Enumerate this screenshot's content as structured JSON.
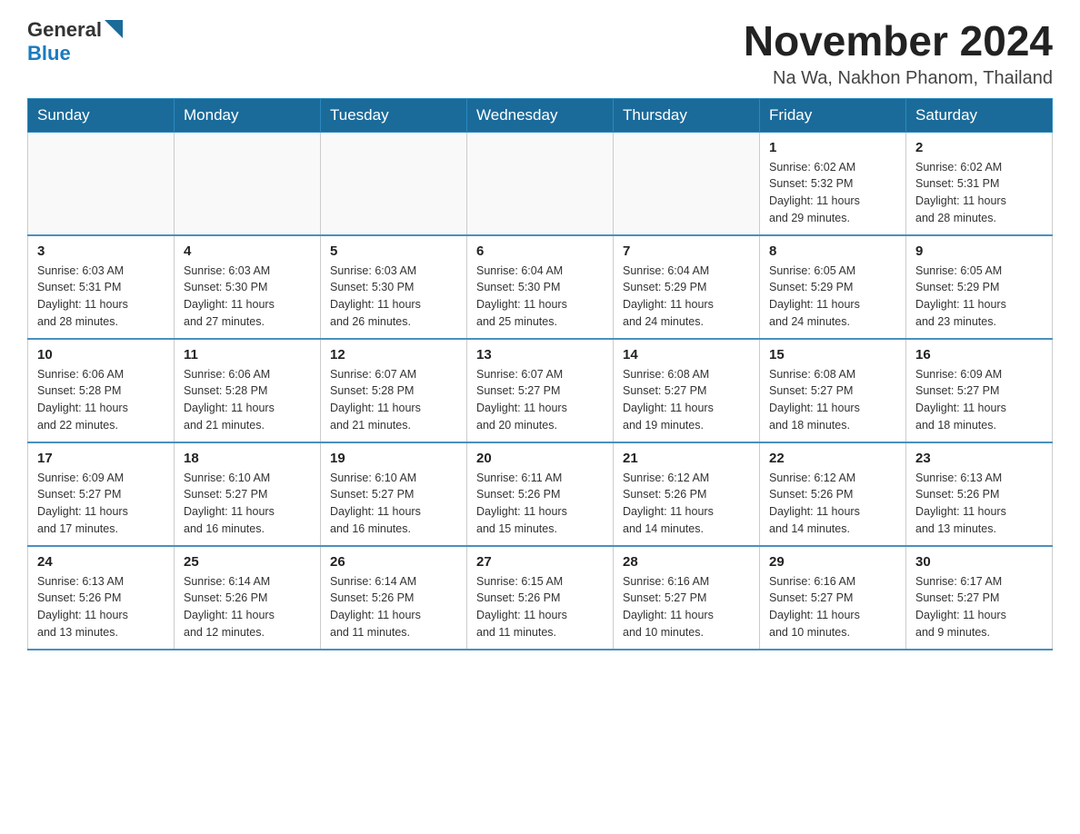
{
  "header": {
    "logo_general": "General",
    "logo_blue": "Blue",
    "title": "November 2024",
    "subtitle": "Na Wa, Nakhon Phanom, Thailand"
  },
  "days_of_week": [
    "Sunday",
    "Monday",
    "Tuesday",
    "Wednesday",
    "Thursday",
    "Friday",
    "Saturday"
  ],
  "weeks": [
    [
      {
        "day": "",
        "info": ""
      },
      {
        "day": "",
        "info": ""
      },
      {
        "day": "",
        "info": ""
      },
      {
        "day": "",
        "info": ""
      },
      {
        "day": "",
        "info": ""
      },
      {
        "day": "1",
        "info": "Sunrise: 6:02 AM\nSunset: 5:32 PM\nDaylight: 11 hours\nand 29 minutes."
      },
      {
        "day": "2",
        "info": "Sunrise: 6:02 AM\nSunset: 5:31 PM\nDaylight: 11 hours\nand 28 minutes."
      }
    ],
    [
      {
        "day": "3",
        "info": "Sunrise: 6:03 AM\nSunset: 5:31 PM\nDaylight: 11 hours\nand 28 minutes."
      },
      {
        "day": "4",
        "info": "Sunrise: 6:03 AM\nSunset: 5:30 PM\nDaylight: 11 hours\nand 27 minutes."
      },
      {
        "day": "5",
        "info": "Sunrise: 6:03 AM\nSunset: 5:30 PM\nDaylight: 11 hours\nand 26 minutes."
      },
      {
        "day": "6",
        "info": "Sunrise: 6:04 AM\nSunset: 5:30 PM\nDaylight: 11 hours\nand 25 minutes."
      },
      {
        "day": "7",
        "info": "Sunrise: 6:04 AM\nSunset: 5:29 PM\nDaylight: 11 hours\nand 24 minutes."
      },
      {
        "day": "8",
        "info": "Sunrise: 6:05 AM\nSunset: 5:29 PM\nDaylight: 11 hours\nand 24 minutes."
      },
      {
        "day": "9",
        "info": "Sunrise: 6:05 AM\nSunset: 5:29 PM\nDaylight: 11 hours\nand 23 minutes."
      }
    ],
    [
      {
        "day": "10",
        "info": "Sunrise: 6:06 AM\nSunset: 5:28 PM\nDaylight: 11 hours\nand 22 minutes."
      },
      {
        "day": "11",
        "info": "Sunrise: 6:06 AM\nSunset: 5:28 PM\nDaylight: 11 hours\nand 21 minutes."
      },
      {
        "day": "12",
        "info": "Sunrise: 6:07 AM\nSunset: 5:28 PM\nDaylight: 11 hours\nand 21 minutes."
      },
      {
        "day": "13",
        "info": "Sunrise: 6:07 AM\nSunset: 5:27 PM\nDaylight: 11 hours\nand 20 minutes."
      },
      {
        "day": "14",
        "info": "Sunrise: 6:08 AM\nSunset: 5:27 PM\nDaylight: 11 hours\nand 19 minutes."
      },
      {
        "day": "15",
        "info": "Sunrise: 6:08 AM\nSunset: 5:27 PM\nDaylight: 11 hours\nand 18 minutes."
      },
      {
        "day": "16",
        "info": "Sunrise: 6:09 AM\nSunset: 5:27 PM\nDaylight: 11 hours\nand 18 minutes."
      }
    ],
    [
      {
        "day": "17",
        "info": "Sunrise: 6:09 AM\nSunset: 5:27 PM\nDaylight: 11 hours\nand 17 minutes."
      },
      {
        "day": "18",
        "info": "Sunrise: 6:10 AM\nSunset: 5:27 PM\nDaylight: 11 hours\nand 16 minutes."
      },
      {
        "day": "19",
        "info": "Sunrise: 6:10 AM\nSunset: 5:27 PM\nDaylight: 11 hours\nand 16 minutes."
      },
      {
        "day": "20",
        "info": "Sunrise: 6:11 AM\nSunset: 5:26 PM\nDaylight: 11 hours\nand 15 minutes."
      },
      {
        "day": "21",
        "info": "Sunrise: 6:12 AM\nSunset: 5:26 PM\nDaylight: 11 hours\nand 14 minutes."
      },
      {
        "day": "22",
        "info": "Sunrise: 6:12 AM\nSunset: 5:26 PM\nDaylight: 11 hours\nand 14 minutes."
      },
      {
        "day": "23",
        "info": "Sunrise: 6:13 AM\nSunset: 5:26 PM\nDaylight: 11 hours\nand 13 minutes."
      }
    ],
    [
      {
        "day": "24",
        "info": "Sunrise: 6:13 AM\nSunset: 5:26 PM\nDaylight: 11 hours\nand 13 minutes."
      },
      {
        "day": "25",
        "info": "Sunrise: 6:14 AM\nSunset: 5:26 PM\nDaylight: 11 hours\nand 12 minutes."
      },
      {
        "day": "26",
        "info": "Sunrise: 6:14 AM\nSunset: 5:26 PM\nDaylight: 11 hours\nand 11 minutes."
      },
      {
        "day": "27",
        "info": "Sunrise: 6:15 AM\nSunset: 5:26 PM\nDaylight: 11 hours\nand 11 minutes."
      },
      {
        "day": "28",
        "info": "Sunrise: 6:16 AM\nSunset: 5:27 PM\nDaylight: 11 hours\nand 10 minutes."
      },
      {
        "day": "29",
        "info": "Sunrise: 6:16 AM\nSunset: 5:27 PM\nDaylight: 11 hours\nand 10 minutes."
      },
      {
        "day": "30",
        "info": "Sunrise: 6:17 AM\nSunset: 5:27 PM\nDaylight: 11 hours\nand 9 minutes."
      }
    ]
  ]
}
